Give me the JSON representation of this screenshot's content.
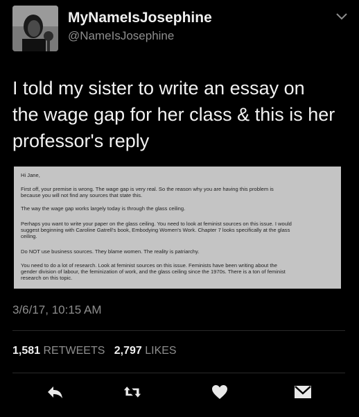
{
  "user": {
    "display_name": "MyNameIsJosephine",
    "handle": "@NameIsJosephine"
  },
  "tweet": {
    "text_lines": [
      "I told my sister to write an essay on",
      "the wage gap for her class & this is her",
      "professor's reply"
    ],
    "timestamp": "3/6/17, 10:15 AM"
  },
  "letter": {
    "greeting": "Hi Jane,",
    "paragraphs": [
      [
        "First off, your premise is wrong.  The wage gap is very real.  So the reason why you are having this problem is",
        "because you will not find any sources that state this."
      ],
      [
        "The way the wage gap works largely today is through the glass ceiling."
      ],
      [
        "Perhaps you want to write your paper on the glass ceiling.  You need to look at feminist sources on this issue.  I would",
        "suggest beginning with Caroline Gatrell's book, Embodying Women's Work.  Chapter 7 looks specifically at the glass",
        "ceiling."
      ],
      [
        "Do NOT use business sources.  They blame women.  The reality is patriarchy."
      ],
      [
        "You need to do a lot of research.  Look at feminist sources on this issue.  Feminists have been writing about the",
        "gender division of labour, the feminization of work, and the glass ceiling since the 1970s.  There is a ton of feminist",
        "research on this topic."
      ]
    ]
  },
  "stats": {
    "retweets_count": "1,581",
    "retweets_label": "RETWEETS",
    "likes_count": "2,797",
    "likes_label": "LIKES"
  },
  "icons": [
    "chevron-down-icon",
    "reply-icon",
    "retweet-icon",
    "like-icon",
    "direct-message-icon"
  ],
  "colors": {
    "background": "#000000",
    "text": "#f2f2f2",
    "secondary": "#8e8e8e",
    "letter_paper": "#c4c4c4"
  }
}
